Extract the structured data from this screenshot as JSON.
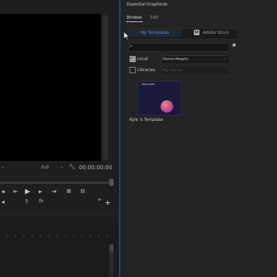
{
  "program_monitor": {
    "fit_label": "Full",
    "timecode": "00:00:00:00",
    "transport_icons": [
      "go-to-in-icon",
      "step-back-icon",
      "play-icon",
      "step-forward-icon",
      "go-to-out-icon",
      "insert-icon",
      "overwrite-icon",
      "export-frame-icon",
      "fx-icon",
      "add-button-icon"
    ],
    "fx_label": "fx",
    "add_label": "+",
    "more_label": "»"
  },
  "essential_graphics": {
    "title": "Essential Graphics",
    "menu_icon": "≡",
    "tabs": [
      {
        "label": "Browse",
        "active": true
      },
      {
        "label": "Edit",
        "active": false
      }
    ],
    "segments": {
      "my_templates": "My Templates",
      "adobe_stock": "Adobe Stock",
      "stock_icon_text": "St"
    },
    "search": {
      "placeholder": "",
      "value": ""
    },
    "filters": {
      "local": {
        "label": "Local",
        "checked": true,
        "dropdown": "Demo Mogrts"
      },
      "libraries": {
        "label": "Libraries",
        "checked": false,
        "dropdown": "My Library"
      }
    },
    "templates": [
      {
        "thumb_text": "Some text",
        "caption": "Kyle 's Template"
      }
    ]
  },
  "colors": {
    "accent_blue": "#5a8ee0",
    "panel_bg": "#232323",
    "video_bg": "#000000"
  }
}
